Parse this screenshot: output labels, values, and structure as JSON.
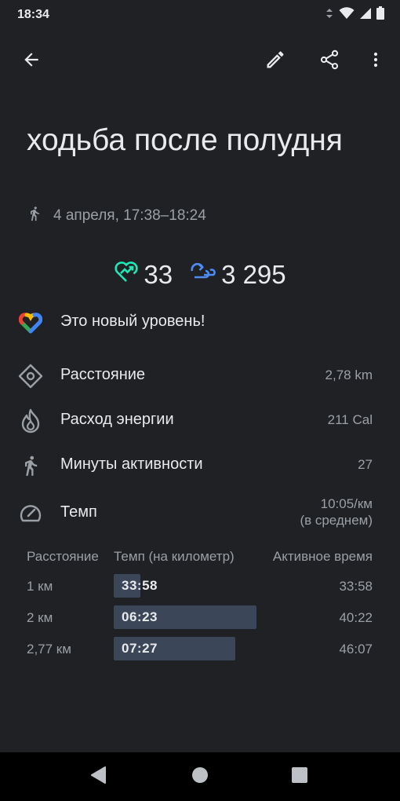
{
  "status_bar": {
    "time": "18:34"
  },
  "activity": {
    "title": "ходьба после полудня",
    "subtitle": "4 апреля, 17:38–18:24",
    "heart_points": "33",
    "steps": "3 295"
  },
  "achievement": {
    "label": "Это новый уровень!"
  },
  "metrics": {
    "distance": {
      "label": "Расстояние",
      "value": "2,78 km"
    },
    "energy": {
      "label": "Расход энергии",
      "value": "211 Cal"
    },
    "move_minutes": {
      "label": "Минуты активности",
      "value": "27"
    },
    "pace": {
      "label": "Темп",
      "value_line1": "10:05/км",
      "value_line2": "(в среднем)"
    }
  },
  "splits": {
    "headers": [
      "Расстояние",
      "Темп (на километр)",
      "Активное время"
    ],
    "rows": [
      {
        "distance": "1 км",
        "pace": "33:58",
        "active_time": "33:58"
      },
      {
        "distance": "2 км",
        "pace": "06:23",
        "active_time": "40:22"
      },
      {
        "distance": "2,77 км",
        "pace": "07:27",
        "active_time": "46:07"
      }
    ]
  },
  "colors": {
    "background": "#202124",
    "heart_points": "#1de9b6",
    "steps": "#4e8cf5",
    "split_bar": "#3c4659"
  }
}
